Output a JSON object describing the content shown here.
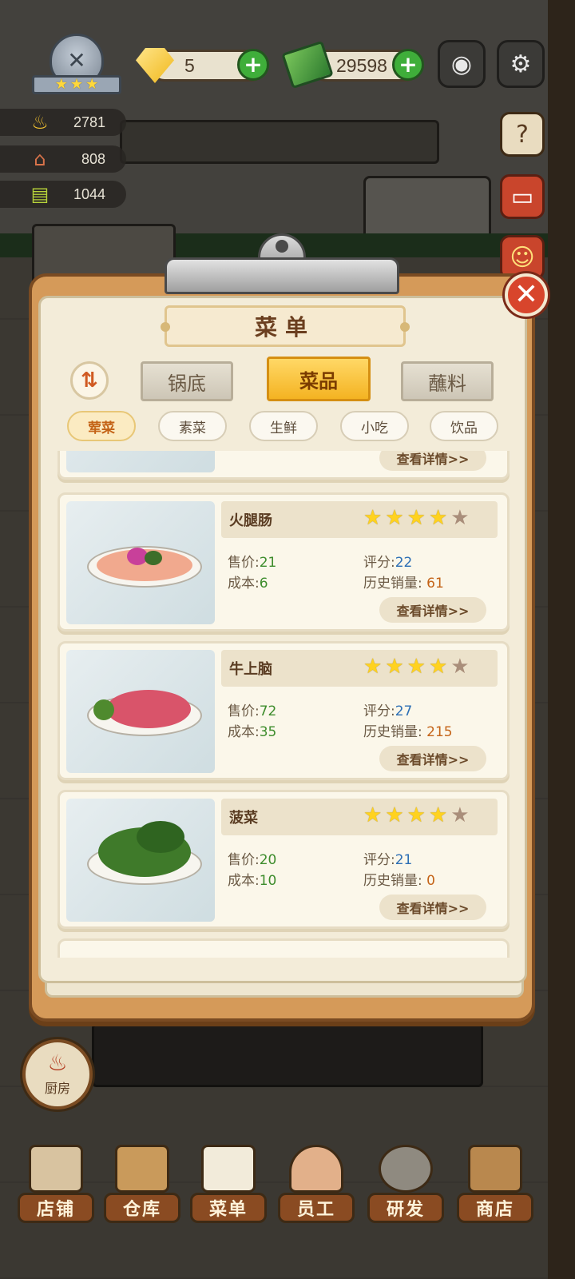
{
  "hud": {
    "gems": "5",
    "cash": "29598",
    "stats": [
      "2781",
      "808",
      "1044"
    ],
    "icons": {
      "rank": "chef-rank-badge-icon",
      "gem": "gem-icon",
      "cash": "cash-icon",
      "camera": "camera-icon",
      "settings": "gear-icon",
      "recipe_book": "recipe-book-icon",
      "red_book": "book-icon",
      "lion": "lion-dance-icon"
    }
  },
  "menu": {
    "title": "菜单",
    "close": "✕",
    "tabs": [
      "锅底",
      "菜品",
      "蘸料"
    ],
    "active_tab": "菜品",
    "categories": [
      "荤菜",
      "素菜",
      "生鲜",
      "小吃",
      "饮品"
    ],
    "active_category": "荤菜",
    "detail_label": "查看详情>>",
    "labels": {
      "price": "售价",
      "cost": "成本",
      "score": "评分",
      "sales": "历史销量"
    },
    "items": [
      {
        "name": "火腿肠",
        "price": "21",
        "cost": "6",
        "score": "22",
        "sales": "61",
        "stars": 4,
        "max_stars": 5
      },
      {
        "name": "牛上脑",
        "price": "72",
        "cost": "35",
        "score": "27",
        "sales": "215",
        "stars": 4,
        "max_stars": 5
      },
      {
        "name": "菠菜",
        "price": "20",
        "cost": "10",
        "score": "21",
        "sales": "0",
        "stars": 4,
        "max_stars": 5
      }
    ]
  },
  "kitchen": {
    "label": "厨房"
  },
  "nav": [
    "店铺",
    "仓库",
    "菜单",
    "员工",
    "研发",
    "商店"
  ],
  "colors": {
    "accent_orange": "#c46317",
    "tab_active": "#f4b322",
    "price_green": "#3d8c2c",
    "score_blue": "#2d6fb5",
    "close_red": "#d8452c"
  }
}
